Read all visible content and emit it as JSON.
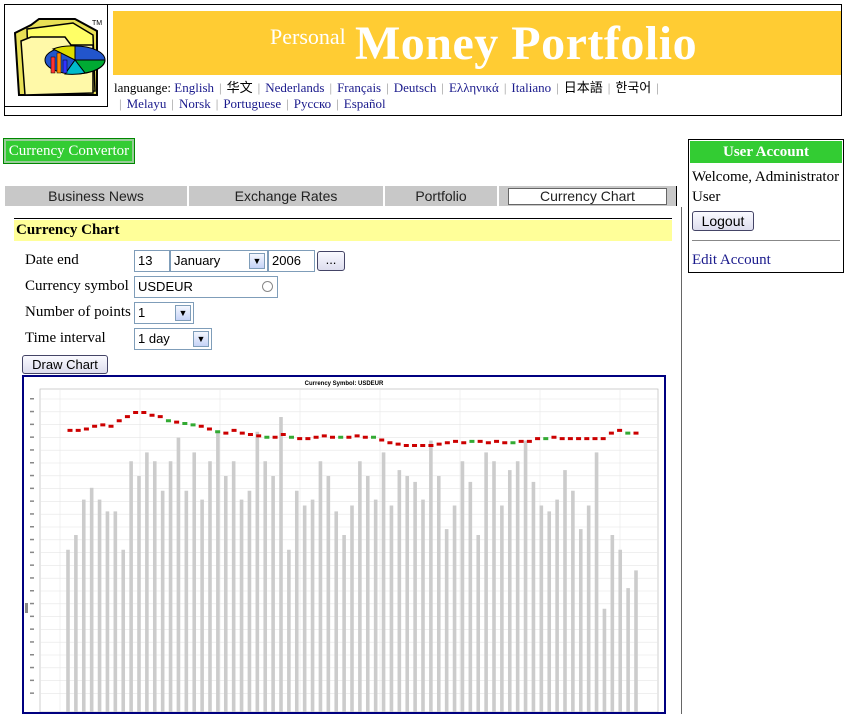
{
  "header": {
    "title_small": "Personal",
    "title_big": "Money Portfolio",
    "tm": "TM",
    "language_label": "languange:",
    "languages": [
      "English",
      "华文",
      "Nederlands",
      "Français",
      "Deutsch",
      "Ελληνικά",
      "Italiano",
      "日本語",
      "한국어",
      "Melayu",
      "Norsk",
      "Portuguese",
      "Русско",
      "Español"
    ]
  },
  "left": {
    "convertor_label": "Currency Convertor"
  },
  "tabs": [
    {
      "label": "Business News"
    },
    {
      "label": "Exchange Rates"
    },
    {
      "label": "Portfolio"
    },
    {
      "label": "Currency Chart",
      "active": true
    }
  ],
  "account": {
    "title": "User Account",
    "welcome": "Welcome, Administrator User",
    "logout": "Logout",
    "edit": "Edit Account"
  },
  "form": {
    "panel_title": "Currency Chart",
    "date_end_label": "Date end",
    "day": "13",
    "month": "January",
    "year": "2006",
    "picker_label": "...",
    "symbol_label": "Currency symbol",
    "symbol": "USDEUR",
    "points_label": "Number of points",
    "points": "1",
    "interval_label": "Time interval",
    "interval": "1 day",
    "draw_label": "Draw Chart"
  },
  "chart_data": {
    "type": "bar",
    "title": "Currency Symbol: USDEUR",
    "ylabel": "",
    "grid": true,
    "candle_colors": {
      "up": "#33aa33",
      "down": "#cc0000",
      "neutral": "#993333"
    },
    "volume_color": "#cccccc",
    "candles": [
      {
        "c": "d",
        "v": 0.805
      },
      {
        "c": "d",
        "v": 0.805
      },
      {
        "c": "d",
        "v": 0.806
      },
      {
        "c": "d",
        "v": 0.808
      },
      {
        "c": "d",
        "v": 0.809
      },
      {
        "c": "d",
        "v": 0.808
      },
      {
        "c": "d",
        "v": 0.812
      },
      {
        "c": "d",
        "v": 0.815
      },
      {
        "c": "d",
        "v": 0.818
      },
      {
        "c": "d",
        "v": 0.818
      },
      {
        "c": "d",
        "v": 0.816
      },
      {
        "c": "d",
        "v": 0.815
      },
      {
        "c": "u",
        "v": 0.812
      },
      {
        "c": "d",
        "v": 0.811
      },
      {
        "c": "u",
        "v": 0.81
      },
      {
        "c": "u",
        "v": 0.809
      },
      {
        "c": "d",
        "v": 0.808
      },
      {
        "c": "d",
        "v": 0.806
      },
      {
        "c": "u",
        "v": 0.804
      },
      {
        "c": "d",
        "v": 0.803
      },
      {
        "c": "d",
        "v": 0.805
      },
      {
        "c": "d",
        "v": 0.803
      },
      {
        "c": "d",
        "v": 0.802
      },
      {
        "c": "d",
        "v": 0.801
      },
      {
        "c": "u",
        "v": 0.8
      },
      {
        "c": "d",
        "v": 0.8
      },
      {
        "c": "d",
        "v": 0.802
      },
      {
        "c": "u",
        "v": 0.8
      },
      {
        "c": "d",
        "v": 0.799
      },
      {
        "c": "d",
        "v": 0.799
      },
      {
        "c": "d",
        "v": 0.8
      },
      {
        "c": "d",
        "v": 0.801
      },
      {
        "c": "d",
        "v": 0.8
      },
      {
        "c": "u",
        "v": 0.8
      },
      {
        "c": "d",
        "v": 0.8
      },
      {
        "c": "d",
        "v": 0.801
      },
      {
        "c": "d",
        "v": 0.8
      },
      {
        "c": "u",
        "v": 0.8
      },
      {
        "c": "d",
        "v": 0.798
      },
      {
        "c": "d",
        "v": 0.796
      },
      {
        "c": "d",
        "v": 0.795
      },
      {
        "c": "d",
        "v": 0.794
      },
      {
        "c": "d",
        "v": 0.794
      },
      {
        "c": "d",
        "v": 0.794
      },
      {
        "c": "d",
        "v": 0.794
      },
      {
        "c": "d",
        "v": 0.795
      },
      {
        "c": "d",
        "v": 0.796
      },
      {
        "c": "d",
        "v": 0.797
      },
      {
        "c": "d",
        "v": 0.796
      },
      {
        "c": "u",
        "v": 0.797
      },
      {
        "c": "d",
        "v": 0.797
      },
      {
        "c": "d",
        "v": 0.796
      },
      {
        "c": "d",
        "v": 0.797
      },
      {
        "c": "d",
        "v": 0.796
      },
      {
        "c": "u",
        "v": 0.796
      },
      {
        "c": "d",
        "v": 0.797
      },
      {
        "c": "d",
        "v": 0.797
      },
      {
        "c": "d",
        "v": 0.799
      },
      {
        "c": "u",
        "v": 0.799
      },
      {
        "c": "d",
        "v": 0.8
      },
      {
        "c": "d",
        "v": 0.799
      },
      {
        "c": "d",
        "v": 0.799
      },
      {
        "c": "d",
        "v": 0.799
      },
      {
        "c": "d",
        "v": 0.799
      },
      {
        "c": "d",
        "v": 0.799
      },
      {
        "c": "d",
        "v": 0.799
      },
      {
        "c": "d",
        "v": 0.803
      },
      {
        "c": "d",
        "v": 0.805
      },
      {
        "c": "u",
        "v": 0.803
      },
      {
        "c": "d",
        "v": 0.803
      }
    ],
    "volumes": [
      0.55,
      0.6,
      0.72,
      0.76,
      0.72,
      0.68,
      0.68,
      0.55,
      0.85,
      0.8,
      0.88,
      0.85,
      0.75,
      0.85,
      0.93,
      0.75,
      0.88,
      0.72,
      0.85,
      0.95,
      0.8,
      0.85,
      0.72,
      0.75,
      0.95,
      0.85,
      0.8,
      1.0,
      0.55,
      0.75,
      0.7,
      0.72,
      0.85,
      0.8,
      0.68,
      0.6,
      0.7,
      0.85,
      0.8,
      0.72,
      0.88,
      0.7,
      0.82,
      0.8,
      0.78,
      0.72,
      0.92,
      0.8,
      0.62,
      0.7,
      0.85,
      0.78,
      0.6,
      0.88,
      0.85,
      0.7,
      0.82,
      0.85,
      0.92,
      0.78,
      0.7,
      0.68,
      0.72,
      0.82,
      0.75,
      0.62,
      0.7,
      0.88,
      0.35,
      0.6,
      0.55,
      0.42,
      0.48
    ]
  }
}
